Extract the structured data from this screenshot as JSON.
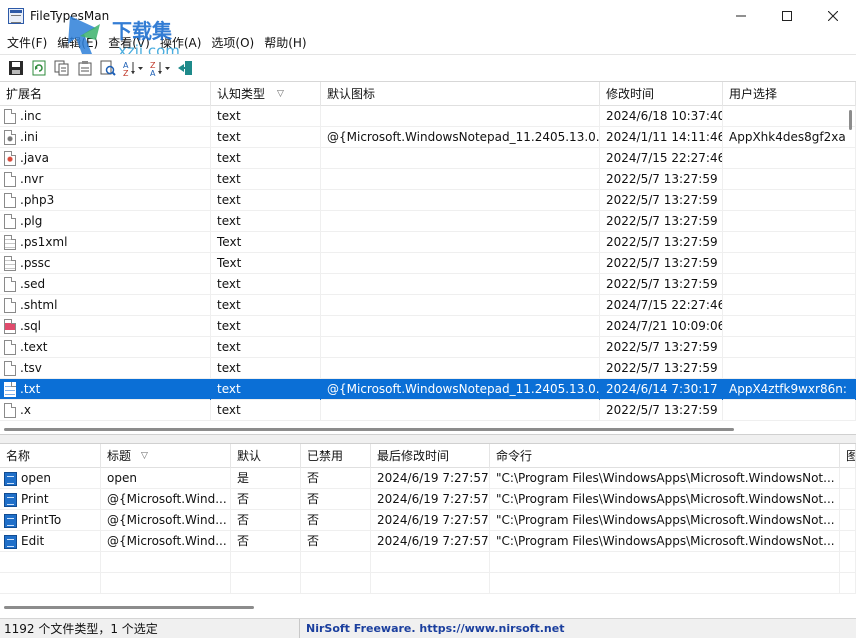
{
  "window": {
    "title": "FileTypesMan",
    "watermark_text": "下载集",
    "watermark_domain": "xzji.com"
  },
  "menu": [
    "文件(F)",
    "编辑(E)",
    "查看(V)",
    "操作(A)",
    "选项(O)",
    "帮助(H)"
  ],
  "top_list": {
    "columns": [
      "扩展名",
      "认知类型",
      "默认图标",
      "修改时间",
      "用户选择"
    ],
    "sort_column": "认知类型",
    "rows": [
      {
        "ext": ".inc",
        "type": "text",
        "icon": "",
        "modified": "2024/6/18 10:37:40",
        "user_choice": "",
        "icon_kind": "plain"
      },
      {
        "ext": ".ini",
        "type": "text",
        "icon": "@{Microsoft.WindowsNotepad_11.2405.13.0...",
        "modified": "2024/1/11 14:11:46",
        "user_choice": "AppXhk4des8gf2xa",
        "icon_kind": "gear"
      },
      {
        "ext": ".java",
        "type": "text",
        "icon": "",
        "modified": "2024/7/15 22:27:46",
        "user_choice": "",
        "icon_kind": "java"
      },
      {
        "ext": ".nvr",
        "type": "text",
        "icon": "",
        "modified": "2022/5/7 13:27:59",
        "user_choice": "",
        "icon_kind": "plain"
      },
      {
        "ext": ".php3",
        "type": "text",
        "icon": "",
        "modified": "2022/5/7 13:27:59",
        "user_choice": "",
        "icon_kind": "plain"
      },
      {
        "ext": ".plg",
        "type": "text",
        "icon": "",
        "modified": "2022/5/7 13:27:59",
        "user_choice": "",
        "icon_kind": "plain"
      },
      {
        "ext": ".ps1xml",
        "type": "Text",
        "icon": "",
        "modified": "2022/5/7 13:27:59",
        "user_choice": "",
        "icon_kind": "lines"
      },
      {
        "ext": ".pssc",
        "type": "Text",
        "icon": "",
        "modified": "2022/5/7 13:27:59",
        "user_choice": "",
        "icon_kind": "lines"
      },
      {
        "ext": ".sed",
        "type": "text",
        "icon": "",
        "modified": "2022/5/7 13:27:59",
        "user_choice": "",
        "icon_kind": "plain"
      },
      {
        "ext": ".shtml",
        "type": "text",
        "icon": "",
        "modified": "2024/7/15 22:27:46",
        "user_choice": "",
        "icon_kind": "plain"
      },
      {
        "ext": ".sql",
        "type": "text",
        "icon": "",
        "modified": "2024/7/21 10:09:06",
        "user_choice": "",
        "icon_kind": "sql"
      },
      {
        "ext": ".text",
        "type": "text",
        "icon": "",
        "modified": "2022/5/7 13:27:59",
        "user_choice": "",
        "icon_kind": "plain"
      },
      {
        "ext": ".tsv",
        "type": "text",
        "icon": "",
        "modified": "2022/5/7 13:27:59",
        "user_choice": "",
        "icon_kind": "plain"
      },
      {
        "ext": ".txt",
        "type": "text",
        "icon": "@{Microsoft.WindowsNotepad_11.2405.13.0...",
        "modified": "2024/6/14 7:30:17",
        "user_choice": "AppX4ztfk9wxr86n:",
        "icon_kind": "txt-sel",
        "selected": true
      },
      {
        "ext": ".x",
        "type": "text",
        "icon": "",
        "modified": "2022/5/7 13:27:59",
        "user_choice": "",
        "icon_kind": "plain"
      }
    ]
  },
  "bottom_list": {
    "columns": [
      "名称",
      "标题",
      "默认",
      "已禁用",
      "最后修改时间",
      "命令行",
      "图"
    ],
    "sort_column": "标题",
    "rows": [
      {
        "name": "open",
        "title": "open",
        "default": "是",
        "disabled": "否",
        "modified": "2024/6/19 7:27:57",
        "command": "\"C:\\Program Files\\WindowsApps\\Microsoft.WindowsNot..."
      },
      {
        "name": "Print",
        "title": "@{Microsoft.Wind...",
        "default": "否",
        "disabled": "否",
        "modified": "2024/6/19 7:27:57",
        "command": "\"C:\\Program Files\\WindowsApps\\Microsoft.WindowsNot..."
      },
      {
        "name": "PrintTo",
        "title": "@{Microsoft.Wind...",
        "default": "否",
        "disabled": "否",
        "modified": "2024/6/19 7:27:57",
        "command": "\"C:\\Program Files\\WindowsApps\\Microsoft.WindowsNot..."
      },
      {
        "name": "Edit",
        "title": "@{Microsoft.Wind...",
        "default": "否",
        "disabled": "否",
        "modified": "2024/6/19 7:27:57",
        "command": "\"C:\\Program Files\\WindowsApps\\Microsoft.WindowsNot..."
      }
    ]
  },
  "status": {
    "count_text": "1192 个文件类型，1 个选定",
    "link_text": "NirSoft Freeware. https://www.nirsoft.net"
  },
  "colors": {
    "selection": "#0b6fd6",
    "link": "#1b3f9e"
  }
}
